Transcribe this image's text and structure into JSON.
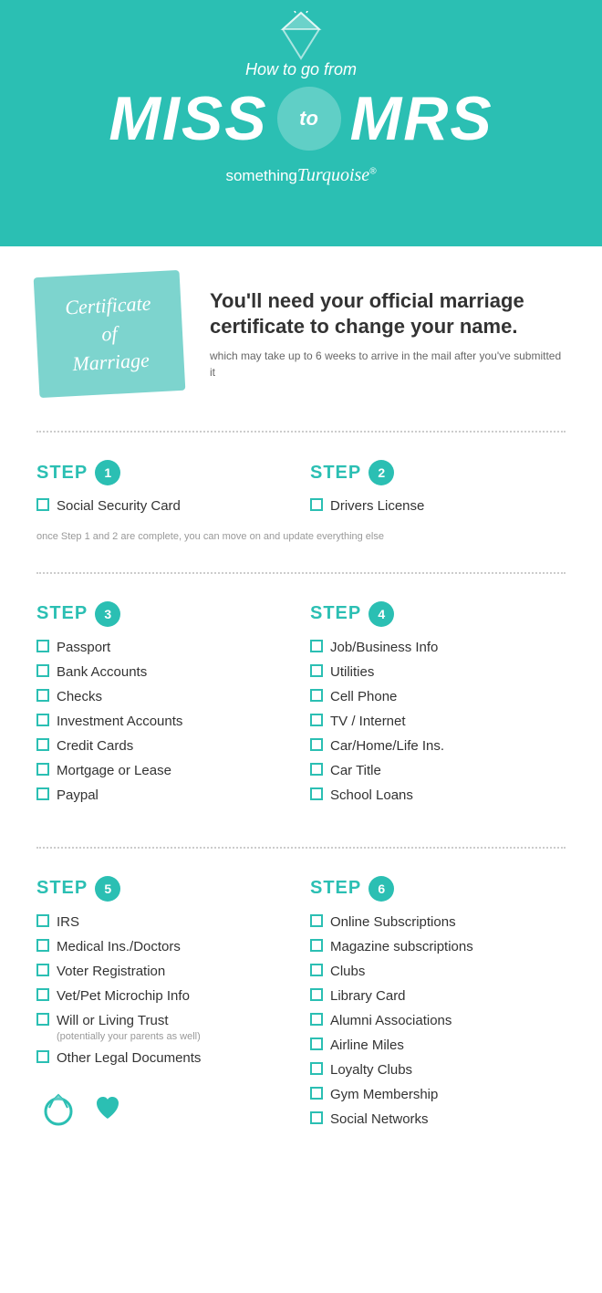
{
  "header": {
    "how_to": "How to go from",
    "miss": "MISS",
    "to": "to",
    "mrs": "MRS",
    "brand": "something Turquoise"
  },
  "certificate": {
    "card_line1": "Certificate",
    "card_line2": "of",
    "card_line3": "Marriage",
    "title": "You'll need your official marriage certificate to change your name.",
    "subtitle": "which may take up to 6 weeks to arrive in the mail after you've submitted it"
  },
  "steps": [
    {
      "id": "step1",
      "number": "1",
      "label": "STEP",
      "items": [
        "Social Security Card"
      ]
    },
    {
      "id": "step2",
      "number": "2",
      "label": "STEP",
      "items": [
        "Drivers License"
      ]
    }
  ],
  "step_note": "once Step 1 and 2 are complete, you can move on and update everything else",
  "steps_row2": [
    {
      "number": "3",
      "label": "STEP",
      "items": [
        "Passport",
        "Bank Accounts",
        "Checks",
        "Investment Accounts",
        "Credit Cards",
        "Mortgage or Lease",
        "Paypal"
      ]
    },
    {
      "number": "4",
      "label": "STEP",
      "items": [
        "Job/Business Info",
        "Utilities",
        "Cell Phone",
        "TV / Internet",
        "Car/Home/Life Ins.",
        "Car Title",
        "School Loans"
      ]
    }
  ],
  "steps_row3": [
    {
      "number": "5",
      "label": "STEP",
      "items": [
        {
          "text": "IRS",
          "sub": ""
        },
        {
          "text": "Medical Ins./Doctors",
          "sub": ""
        },
        {
          "text": "Voter Registration",
          "sub": ""
        },
        {
          "text": "Vet/Pet Microchip Info",
          "sub": ""
        },
        {
          "text": "Will or Living Trust",
          "sub": "(potentially your parents as well)"
        },
        {
          "text": "Other Legal Documents",
          "sub": ""
        }
      ]
    },
    {
      "number": "6",
      "label": "STEP",
      "items": [
        {
          "text": "Online Subscriptions",
          "sub": ""
        },
        {
          "text": "Magazine subscriptions",
          "sub": ""
        },
        {
          "text": "Clubs",
          "sub": ""
        },
        {
          "text": "Library Card",
          "sub": ""
        },
        {
          "text": "Alumni Associations",
          "sub": ""
        },
        {
          "text": "Airline Miles",
          "sub": ""
        },
        {
          "text": "Loyalty Clubs",
          "sub": ""
        },
        {
          "text": "Gym Membership",
          "sub": ""
        },
        {
          "text": "Social Networks",
          "sub": ""
        }
      ]
    }
  ],
  "colors": {
    "teal": "#2BBFB3",
    "light_teal": "#7DD4CE",
    "text_dark": "#333333",
    "text_grey": "#666666",
    "dotted": "#cccccc"
  }
}
